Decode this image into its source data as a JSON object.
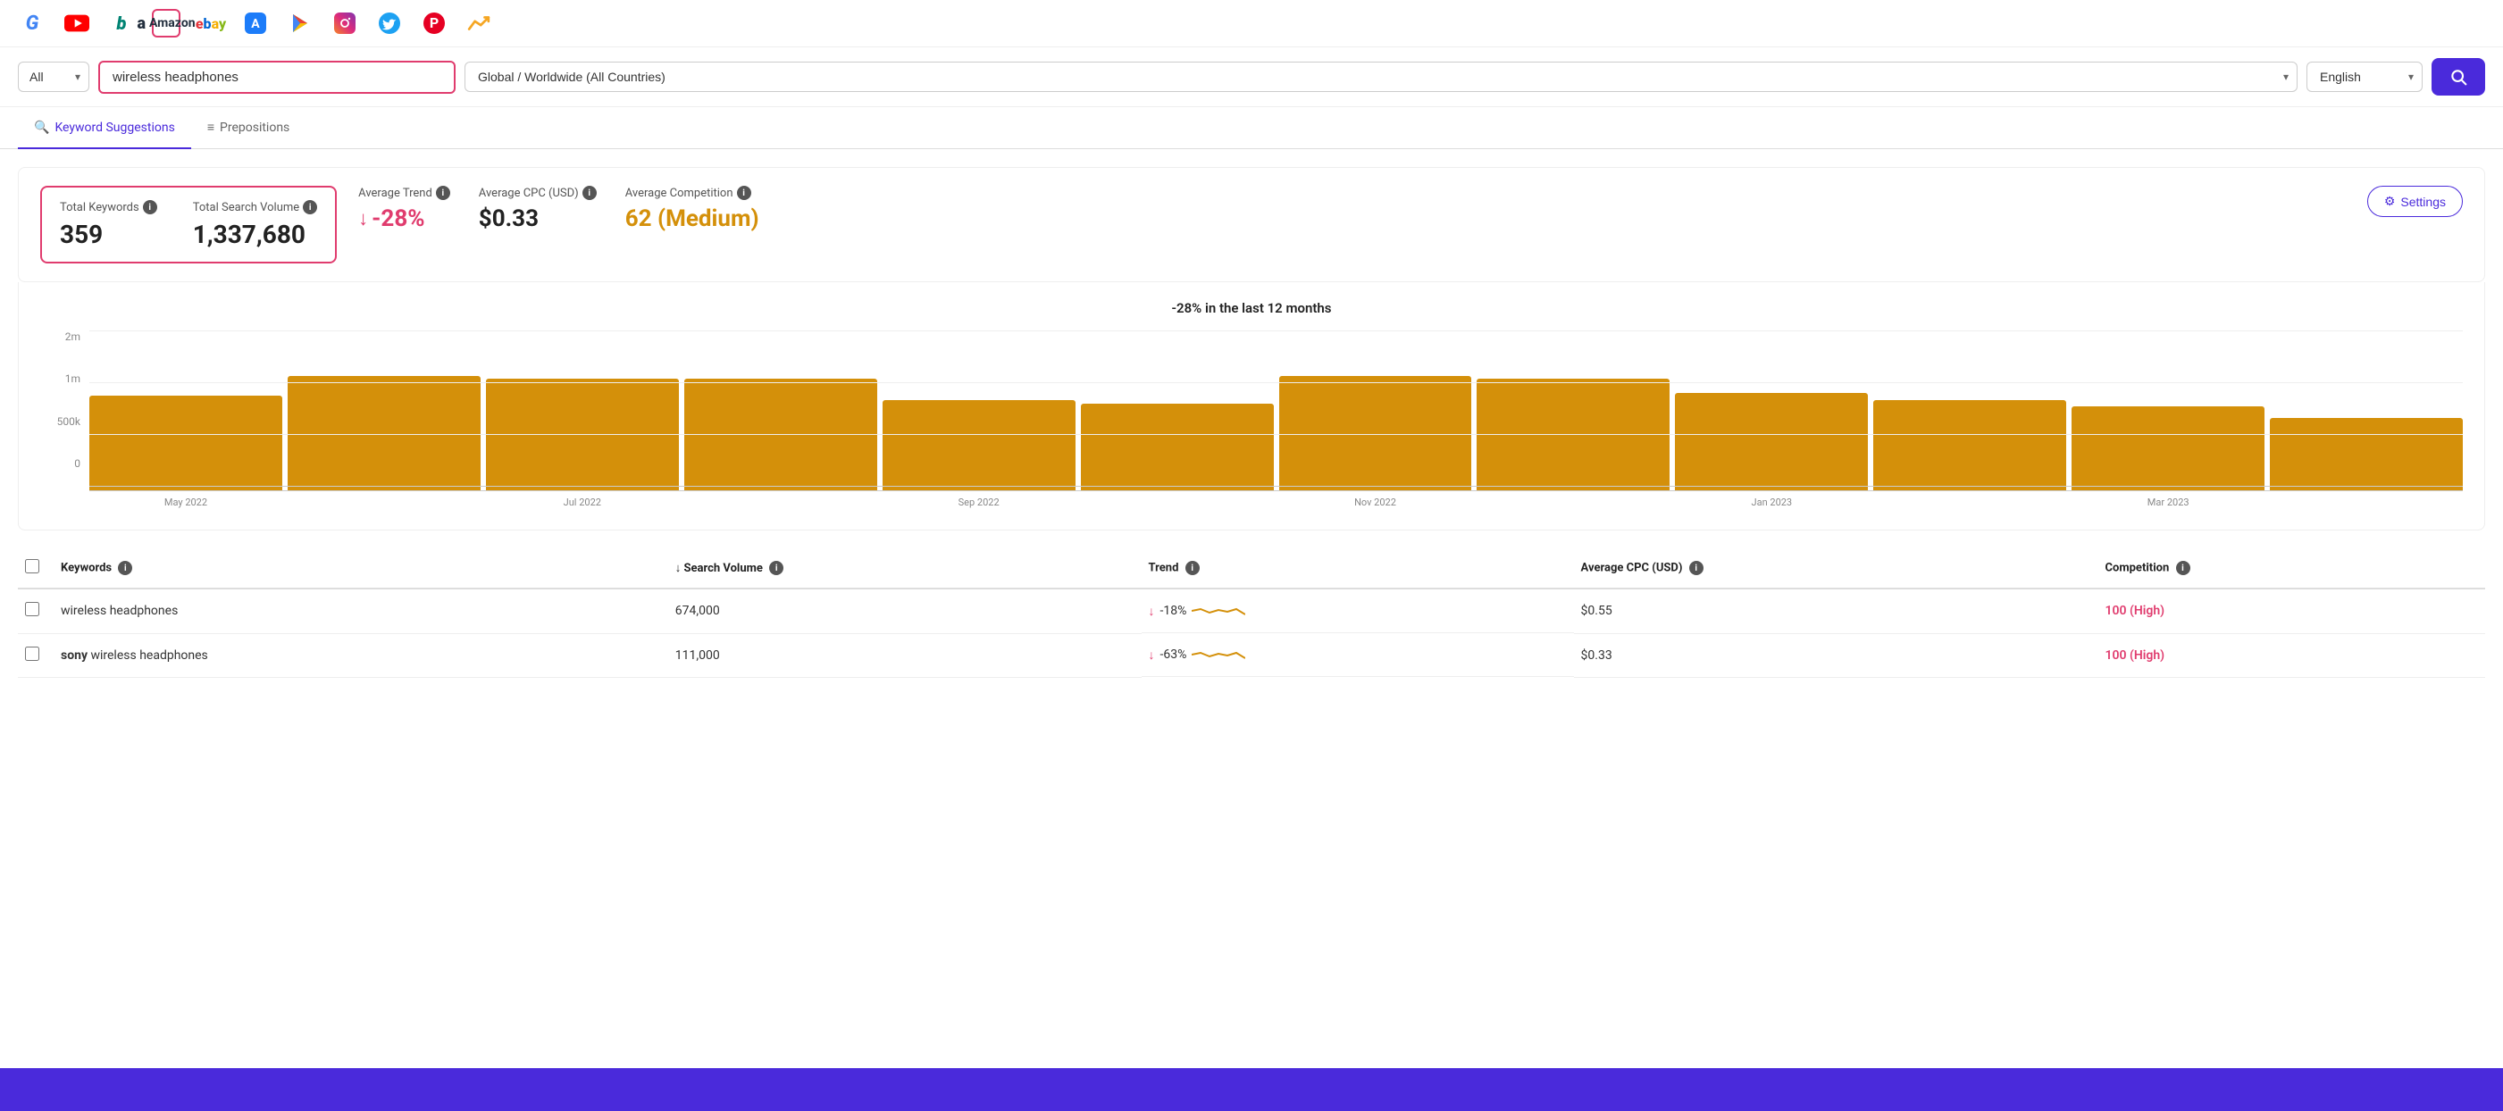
{
  "nav": {
    "icons": [
      {
        "name": "google",
        "label": "G",
        "type": "text"
      },
      {
        "name": "youtube",
        "label": "▶",
        "type": "yt"
      },
      {
        "name": "bing",
        "label": "b",
        "type": "text"
      },
      {
        "name": "amazon",
        "label": "Amazon",
        "type": "amazon"
      },
      {
        "name": "ebay",
        "label": "ebay",
        "type": "text"
      },
      {
        "name": "apple-appstore",
        "label": "A",
        "type": "text"
      },
      {
        "name": "google-play",
        "label": "▶",
        "type": "play"
      },
      {
        "name": "instagram",
        "label": "📷",
        "type": "text"
      },
      {
        "name": "twitter",
        "label": "🐦",
        "type": "text"
      },
      {
        "name": "pinterest",
        "label": "P",
        "type": "text"
      },
      {
        "name": "trends",
        "label": "↗",
        "type": "text"
      }
    ]
  },
  "search": {
    "type_label": "All",
    "query": "wireless headphones",
    "location": "Global / Worldwide (All Countries)",
    "language": "English",
    "search_btn_label": "Search"
  },
  "tabs": [
    {
      "id": "keyword-suggestions",
      "label": "Keyword Suggestions",
      "active": true
    },
    {
      "id": "prepositions",
      "label": "Prepositions",
      "active": false
    }
  ],
  "stats": {
    "total_keywords_label": "Total Keywords",
    "total_keywords_value": "359",
    "total_search_volume_label": "Total Search Volume",
    "total_search_volume_value": "1,337,680",
    "average_trend_label": "Average Trend",
    "average_trend_value": "-28%",
    "average_cpc_label": "Average CPC (USD)",
    "average_cpc_value": "$0.33",
    "average_competition_label": "Average Competition",
    "average_competition_value": "62 (Medium)",
    "settings_label": "Settings"
  },
  "chart": {
    "title": "-28% in the last 12 months",
    "y_axis": [
      "2m",
      "1m",
      "500k",
      "0"
    ],
    "bars": [
      {
        "label": "May 2022",
        "height": 68
      },
      {
        "label": "",
        "height": 82
      },
      {
        "label": "Jul 2022",
        "height": 80
      },
      {
        "label": "",
        "height": 80
      },
      {
        "label": "Sep 2022",
        "height": 65
      },
      {
        "label": "",
        "height": 62
      },
      {
        "label": "Nov 2022",
        "height": 82
      },
      {
        "label": "",
        "height": 80
      },
      {
        "label": "Jan 2023",
        "height": 70
      },
      {
        "label": "",
        "height": 65
      },
      {
        "label": "Mar 2023",
        "height": 60
      },
      {
        "label": "",
        "height": 52
      }
    ]
  },
  "table": {
    "columns": [
      {
        "id": "checkbox",
        "label": ""
      },
      {
        "id": "keyword",
        "label": "Keywords"
      },
      {
        "id": "search_volume",
        "label": "↓ Search Volume"
      },
      {
        "id": "trend",
        "label": "Trend"
      },
      {
        "id": "avg_cpc",
        "label": "Average CPC (USD)"
      },
      {
        "id": "competition",
        "label": "Competition"
      }
    ],
    "rows": [
      {
        "keyword": "wireless headphones",
        "keyword_bold": "",
        "search_volume": "674,000",
        "trend": "-18%",
        "trend_dir": "down",
        "avg_cpc": "$0.55",
        "competition": "100 (High)",
        "competition_level": "high"
      },
      {
        "keyword": "wireless headphones",
        "keyword_bold": "sony",
        "search_volume": "111,000",
        "trend": "-63%",
        "trend_dir": "down",
        "avg_cpc": "$0.33",
        "competition": "100 (High)",
        "competition_level": "high"
      }
    ]
  }
}
